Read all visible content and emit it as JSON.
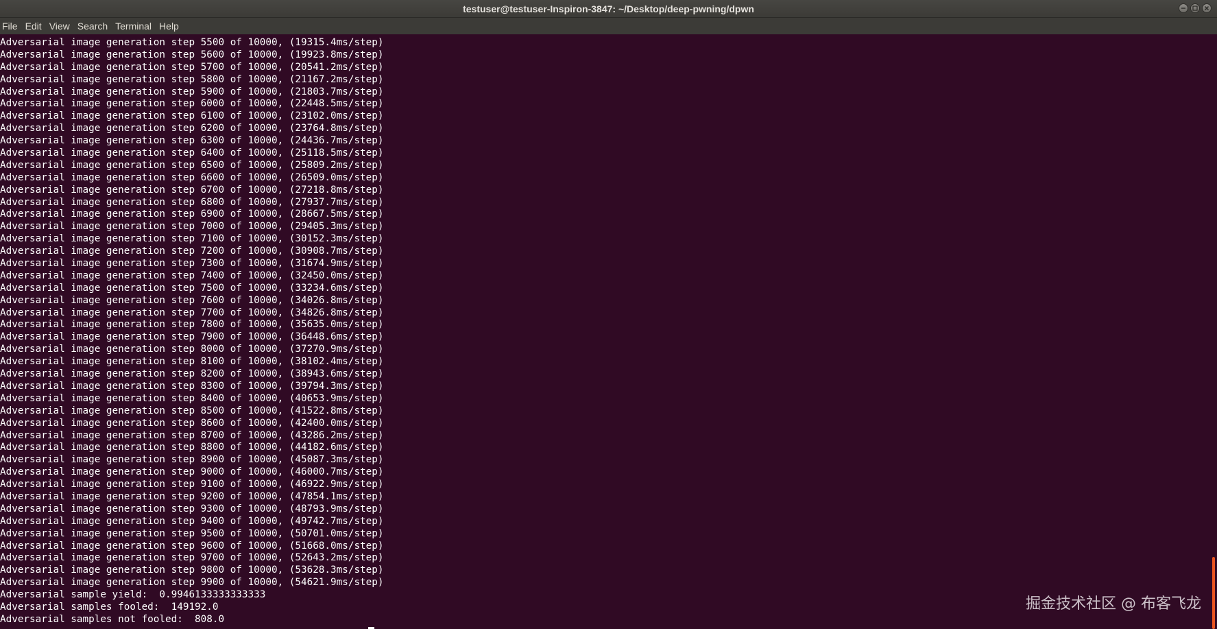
{
  "window": {
    "title": "testuser@testuser-Inspiron-3847: ~/Desktop/deep-pwning/dpwn",
    "controls": [
      "minimize-icon",
      "maximize-icon",
      "close-icon"
    ]
  },
  "menubar": {
    "items": [
      "File",
      "Edit",
      "View",
      "Search",
      "Terminal",
      "Help"
    ]
  },
  "terminal": {
    "lines": [
      "Adversarial image generation step 5500 of 10000, (19315.4ms/step)",
      "Adversarial image generation step 5600 of 10000, (19923.8ms/step)",
      "Adversarial image generation step 5700 of 10000, (20541.2ms/step)",
      "Adversarial image generation step 5800 of 10000, (21167.2ms/step)",
      "Adversarial image generation step 5900 of 10000, (21803.7ms/step)",
      "Adversarial image generation step 6000 of 10000, (22448.5ms/step)",
      "Adversarial image generation step 6100 of 10000, (23102.0ms/step)",
      "Adversarial image generation step 6200 of 10000, (23764.8ms/step)",
      "Adversarial image generation step 6300 of 10000, (24436.7ms/step)",
      "Adversarial image generation step 6400 of 10000, (25118.5ms/step)",
      "Adversarial image generation step 6500 of 10000, (25809.2ms/step)",
      "Adversarial image generation step 6600 of 10000, (26509.0ms/step)",
      "Adversarial image generation step 6700 of 10000, (27218.8ms/step)",
      "Adversarial image generation step 6800 of 10000, (27937.7ms/step)",
      "Adversarial image generation step 6900 of 10000, (28667.5ms/step)",
      "Adversarial image generation step 7000 of 10000, (29405.3ms/step)",
      "Adversarial image generation step 7100 of 10000, (30152.3ms/step)",
      "Adversarial image generation step 7200 of 10000, (30908.7ms/step)",
      "Adversarial image generation step 7300 of 10000, (31674.9ms/step)",
      "Adversarial image generation step 7400 of 10000, (32450.0ms/step)",
      "Adversarial image generation step 7500 of 10000, (33234.6ms/step)",
      "Adversarial image generation step 7600 of 10000, (34026.8ms/step)",
      "Adversarial image generation step 7700 of 10000, (34826.8ms/step)",
      "Adversarial image generation step 7800 of 10000, (35635.0ms/step)",
      "Adversarial image generation step 7900 of 10000, (36448.6ms/step)",
      "Adversarial image generation step 8000 of 10000, (37270.9ms/step)",
      "Adversarial image generation step 8100 of 10000, (38102.4ms/step)",
      "Adversarial image generation step 8200 of 10000, (38943.6ms/step)",
      "Adversarial image generation step 8300 of 10000, (39794.3ms/step)",
      "Adversarial image generation step 8400 of 10000, (40653.9ms/step)",
      "Adversarial image generation step 8500 of 10000, (41522.8ms/step)",
      "Adversarial image generation step 8600 of 10000, (42400.0ms/step)",
      "Adversarial image generation step 8700 of 10000, (43286.2ms/step)",
      "Adversarial image generation step 8800 of 10000, (44182.6ms/step)",
      "Adversarial image generation step 8900 of 10000, (45087.3ms/step)",
      "Adversarial image generation step 9000 of 10000, (46000.7ms/step)",
      "Adversarial image generation step 9100 of 10000, (46922.9ms/step)",
      "Adversarial image generation step 9200 of 10000, (47854.1ms/step)",
      "Adversarial image generation step 9300 of 10000, (48793.9ms/step)",
      "Adversarial image generation step 9400 of 10000, (49742.7ms/step)",
      "Adversarial image generation step 9500 of 10000, (50701.0ms/step)",
      "Adversarial image generation step 9600 of 10000, (51668.0ms/step)",
      "Adversarial image generation step 9700 of 10000, (52643.2ms/step)",
      "Adversarial image generation step 9800 of 10000, (53628.3ms/step)",
      "Adversarial image generation step 9900 of 10000, (54621.9ms/step)",
      "Adversarial sample yield:  0.9946133333333333",
      "Adversarial samples fooled:  149192.0",
      "Adversarial samples not fooled:  808.0"
    ]
  },
  "watermark": {
    "text": "掘金技术社区 @ 布客飞龙"
  },
  "colors": {
    "terminal_bg": "#300a24",
    "terminal_fg": "#ffffff",
    "titlebar_bg": "#3c3b37",
    "scrollbar_accent": "#e95420"
  }
}
